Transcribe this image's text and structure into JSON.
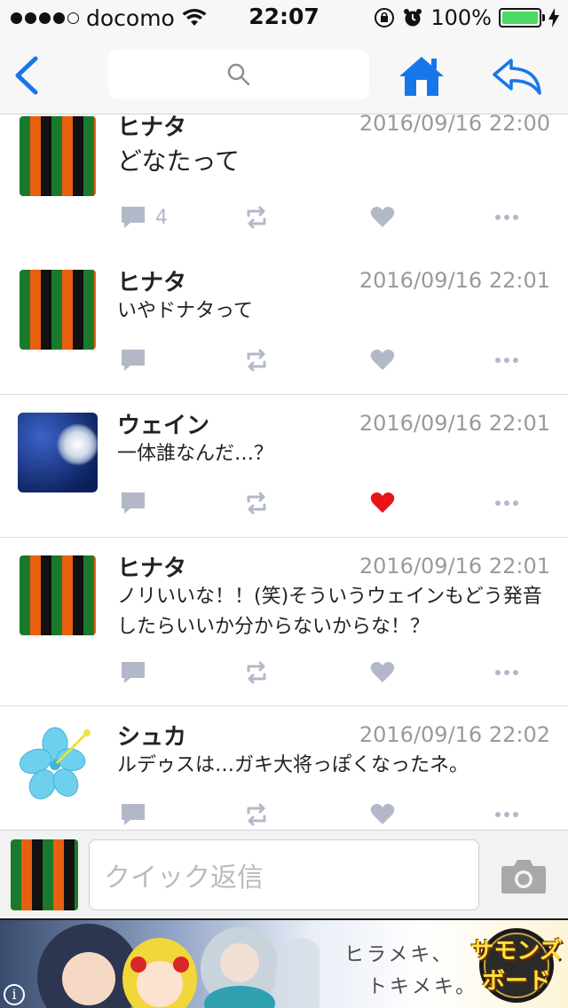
{
  "status_bar": {
    "carrier": "docomo",
    "time": "22:07",
    "battery": "100%",
    "signal_bars": 5
  },
  "nav": {
    "search_icon": "search-icon",
    "home_icon": "home-icon",
    "reply_icon": "reply-icon",
    "accent_color": "#1877e8"
  },
  "tweets": [
    {
      "name": "ヒナタ",
      "time": "2016/09/16 22:00",
      "text": "どなたって",
      "reply_count": "4",
      "liked": false
    },
    {
      "name": "ヒナタ",
      "time": "2016/09/16 22:01",
      "text": "いやドナタって",
      "reply_count": "",
      "liked": false
    },
    {
      "name": "ウェイン",
      "time": "2016/09/16 22:01",
      "text": "一体誰なんだ…？",
      "reply_count": "",
      "liked": true
    },
    {
      "name": "ヒナタ",
      "time": "2016/09/16 22:01",
      "text": "ノリいいな！！(笑)そういうウェインもどう発音したらいいか分からないからな！？",
      "reply_count": "",
      "liked": false
    },
    {
      "name": "シュカ",
      "time": "2016/09/16 22:02",
      "text": "ルデゥスは…ガキ大将っぽくなったネ。",
      "reply_count": "",
      "liked": false
    }
  ],
  "quick_reply": {
    "placeholder": "クイック返信"
  },
  "ad": {
    "line1": "ヒラメキ、",
    "line2": "トキメキ。",
    "logo_line1": "サモンズ",
    "logo_line2": "ボード",
    "info": "i"
  },
  "colors": {
    "like_active": "#e8141a",
    "action_gray": "#b3b8c8"
  }
}
